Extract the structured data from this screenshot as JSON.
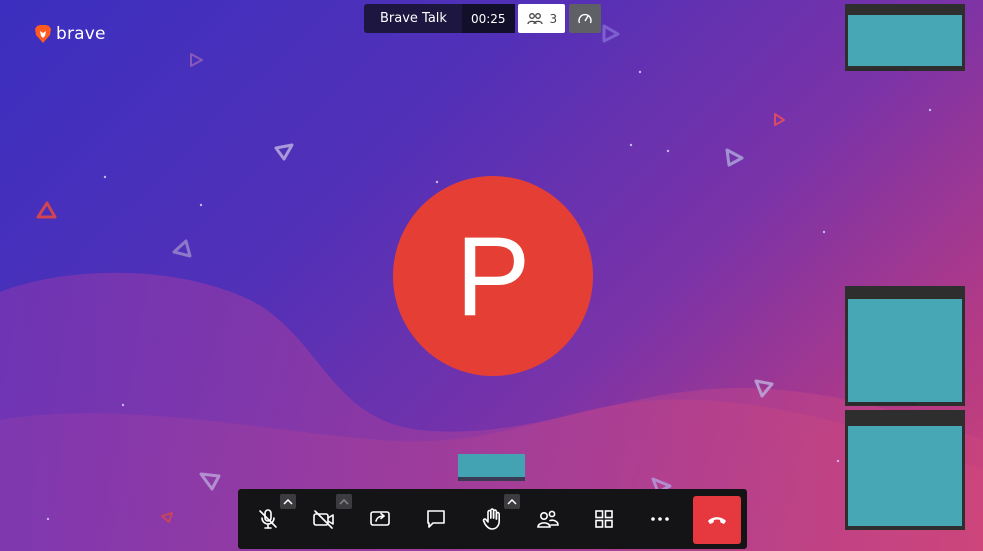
{
  "brand": {
    "logo_text": "brave",
    "icon": "brave-lion-icon"
  },
  "meeting": {
    "room_name": "Brave Talk",
    "timer": "00:25",
    "participant_count": "3"
  },
  "speaker": {
    "initial": "P",
    "avatar_color": "#e53f35"
  },
  "thumbnail_color": "#47a7b5",
  "toolbar": {
    "buttons": [
      {
        "name": "microphone-muted",
        "icon": "mic-off-icon",
        "has_options": true
      },
      {
        "name": "camera-off",
        "icon": "camera-off-icon",
        "has_options": true
      },
      {
        "name": "share-screen",
        "icon": "screen-share-icon",
        "has_options": false
      },
      {
        "name": "chat",
        "icon": "chat-icon",
        "has_options": false
      },
      {
        "name": "raise-hand",
        "icon": "hand-icon",
        "has_options": true
      },
      {
        "name": "participants",
        "icon": "participants-icon",
        "has_options": false
      },
      {
        "name": "tile-view",
        "icon": "grid-icon",
        "has_options": false
      },
      {
        "name": "more-actions",
        "icon": "more-icon",
        "has_options": false
      },
      {
        "name": "leave-call",
        "icon": "hangup-icon",
        "has_options": false
      }
    ],
    "hangup_color": "#e5393f"
  }
}
